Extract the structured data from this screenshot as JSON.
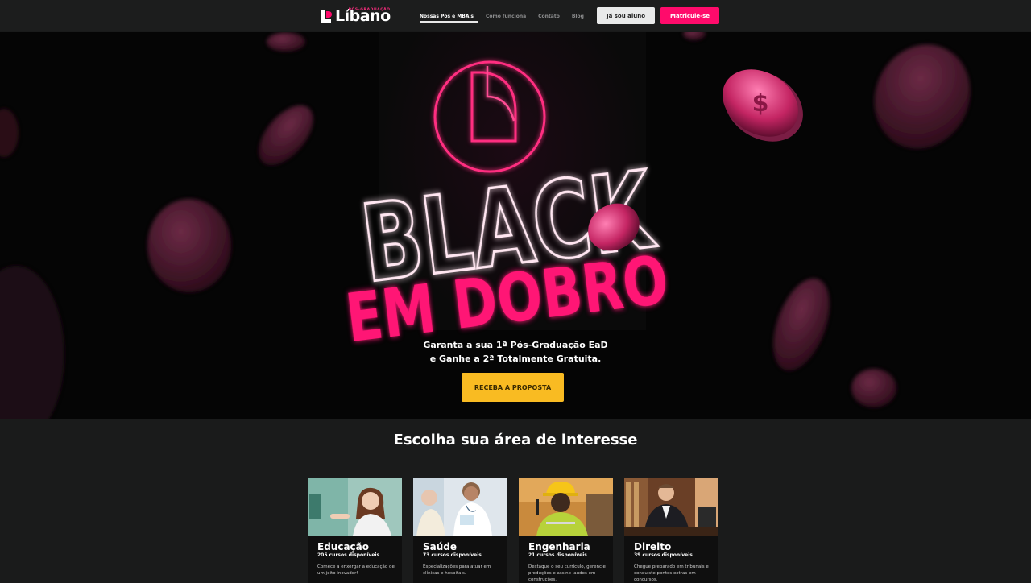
{
  "header": {
    "logo_text": "Líbano",
    "logo_sub": "PÓS-GRADUAÇÃO",
    "nav": [
      "Nossas Pós e MBA's",
      "Como funciona",
      "Contato",
      "Blog"
    ],
    "btn_aluno": "Já sou aluno",
    "btn_matricule": "Matricule-se"
  },
  "hero": {
    "banner_line1": "BLACK",
    "banner_line2": "EM DOBRO",
    "text_line1": "Garanta a sua 1ª Pós-Graduação EaD",
    "text_line2": "e Ganhe a 2ª Totalmente Gratuita.",
    "cta": "RECEBA A PROPOSTA"
  },
  "section": {
    "title": "Escolha sua área de interesse"
  },
  "cards": [
    {
      "title": "Educação",
      "count": "205 cursos disponíveis",
      "desc": "Comece a enxergar a educação de um jeito inovador!"
    },
    {
      "title": "Saúde",
      "count": "73 cursos disponíveis",
      "desc": "Especializações para atuar em clínicas e hospitais."
    },
    {
      "title": "Engenharia",
      "count": "21 cursos disponíveis",
      "desc": "Destaque o seu currículo, gerencie produções e assine laudos em construções."
    },
    {
      "title": "Direito",
      "count": "39 cursos disponíveis",
      "desc": "Chegue preparado em tribunais e conquiste pontos extras em concursos."
    }
  ],
  "colors": {
    "brand_pink": "#ff0b6b",
    "cta_yellow": "#f9bb22",
    "background": "#1a1b1b"
  }
}
